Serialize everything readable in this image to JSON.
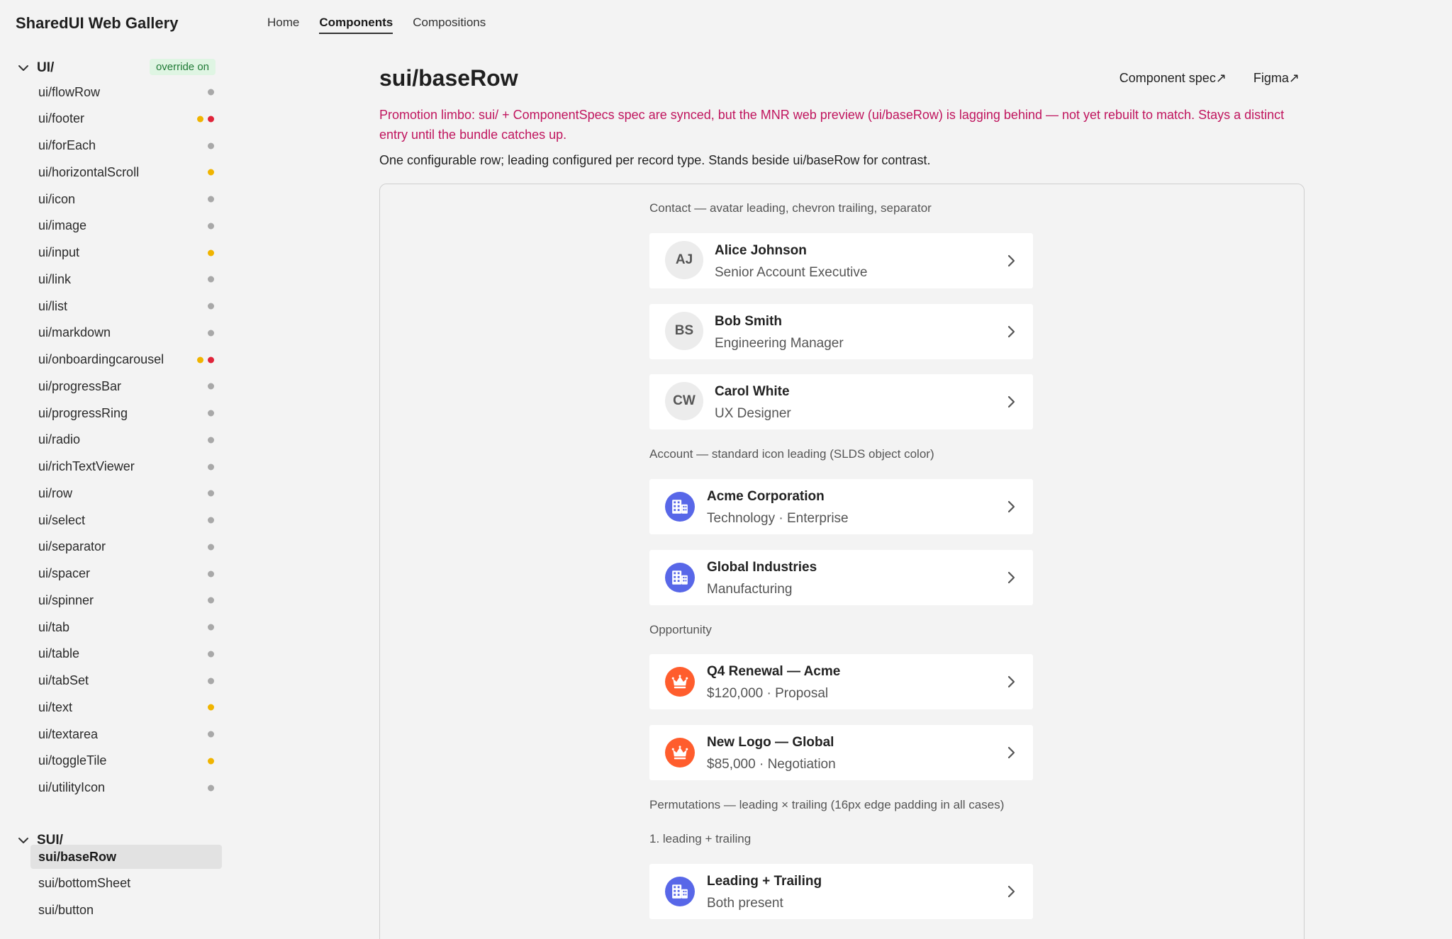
{
  "app_title": "SharedUI Web Gallery",
  "nav": [
    {
      "label": "Home",
      "active": false
    },
    {
      "label": "Components",
      "active": true
    },
    {
      "label": "Compositions",
      "active": false
    }
  ],
  "sidebar": {
    "groups": [
      {
        "label": "UI/",
        "badge": "override on",
        "items": [
          {
            "label": "ui/flowRow",
            "dots": [
              "#a8a8a8"
            ]
          },
          {
            "label": "ui/footer",
            "dots": [
              "#f0b400",
              "#e0243a"
            ]
          },
          {
            "label": "ui/forEach",
            "dots": [
              "#a8a8a8"
            ]
          },
          {
            "label": "ui/horizontalScroll",
            "dots": [
              "#f0b400"
            ]
          },
          {
            "label": "ui/icon",
            "dots": [
              "#a8a8a8"
            ]
          },
          {
            "label": "ui/image",
            "dots": [
              "#a8a8a8"
            ]
          },
          {
            "label": "ui/input",
            "dots": [
              "#f0b400"
            ]
          },
          {
            "label": "ui/link",
            "dots": [
              "#a8a8a8"
            ]
          },
          {
            "label": "ui/list",
            "dots": [
              "#a8a8a8"
            ]
          },
          {
            "label": "ui/markdown",
            "dots": [
              "#a8a8a8"
            ]
          },
          {
            "label": "ui/onboardingcarousel",
            "dots": [
              "#f0b400",
              "#e0243a"
            ]
          },
          {
            "label": "ui/progressBar",
            "dots": [
              "#a8a8a8"
            ]
          },
          {
            "label": "ui/progressRing",
            "dots": [
              "#a8a8a8"
            ]
          },
          {
            "label": "ui/radio",
            "dots": [
              "#a8a8a8"
            ]
          },
          {
            "label": "ui/richTextViewer",
            "dots": [
              "#a8a8a8"
            ]
          },
          {
            "label": "ui/row",
            "dots": [
              "#a8a8a8"
            ]
          },
          {
            "label": "ui/select",
            "dots": [
              "#a8a8a8"
            ]
          },
          {
            "label": "ui/separator",
            "dots": [
              "#a8a8a8"
            ]
          },
          {
            "label": "ui/spacer",
            "dots": [
              "#a8a8a8"
            ]
          },
          {
            "label": "ui/spinner",
            "dots": [
              "#a8a8a8"
            ]
          },
          {
            "label": "ui/tab",
            "dots": [
              "#a8a8a8"
            ]
          },
          {
            "label": "ui/table",
            "dots": [
              "#a8a8a8"
            ]
          },
          {
            "label": "ui/tabSet",
            "dots": [
              "#a8a8a8"
            ]
          },
          {
            "label": "ui/text",
            "dots": [
              "#f0b400"
            ]
          },
          {
            "label": "ui/textarea",
            "dots": [
              "#a8a8a8"
            ]
          },
          {
            "label": "ui/toggleTile",
            "dots": [
              "#f0b400"
            ]
          },
          {
            "label": "ui/utilityIcon",
            "dots": [
              "#a8a8a8"
            ]
          }
        ]
      },
      {
        "label": "SUI/",
        "badge": "",
        "items": [
          {
            "label": "sui/baseRow",
            "dots": [],
            "active": true
          },
          {
            "label": "sui/bottomSheet",
            "dots": []
          },
          {
            "label": "sui/button",
            "dots": []
          }
        ]
      }
    ]
  },
  "main": {
    "title": "sui/baseRow",
    "links": [
      "Component spec↗",
      "Figma↗"
    ],
    "warning": "Promotion limbo: sui/ + ComponentSpecs spec are synced, but the MNR web preview (ui/baseRow) is lagging behind — not yet rebuilt to match. Stays a distinct entry until the bundle catches up.",
    "description": "One configurable row; leading configured per record type. Stands beside ui/baseRow for contrast.",
    "sections": [
      {
        "label": "Contact — avatar leading, chevron trailing, separator",
        "rows": [
          {
            "leading": "avatar",
            "initials": "AJ",
            "title": "Alice Johnson",
            "subtitle": "Senior Account Executive"
          },
          {
            "leading": "avatar",
            "initials": "BS",
            "title": "Bob Smith",
            "subtitle": "Engineering Manager"
          },
          {
            "leading": "avatar",
            "initials": "CW",
            "title": "Carol White",
            "subtitle": "UX Designer"
          }
        ]
      },
      {
        "label": "Account — standard icon leading (SLDS object color)",
        "rows": [
          {
            "leading": "account-icon",
            "title": "Acme Corporation",
            "subtitle": "Technology · Enterprise"
          },
          {
            "leading": "account-icon",
            "title": "Global Industries",
            "subtitle": "Manufacturing"
          }
        ]
      },
      {
        "label": "Opportunity",
        "rows": [
          {
            "leading": "opportunity-icon",
            "title": "Q4 Renewal — Acme",
            "subtitle": "$120,000 · Proposal"
          },
          {
            "leading": "opportunity-icon",
            "title": "New Logo — Global",
            "subtitle": "$85,000 · Negotiation"
          }
        ]
      },
      {
        "label": "Permutations — leading × trailing (16px edge padding in all cases)",
        "sublabel": "1. leading + trailing",
        "rows": [
          {
            "leading": "account-icon",
            "title": "Leading + Trailing",
            "subtitle": "Both present"
          }
        ]
      }
    ]
  },
  "colors": {
    "account_icon_bg": "#5867e8",
    "opportunity_icon_bg": "#ff5d2d",
    "warning_text": "#c0155e",
    "badge_bg": "#dff5e3",
    "badge_text": "#1f7a35"
  }
}
